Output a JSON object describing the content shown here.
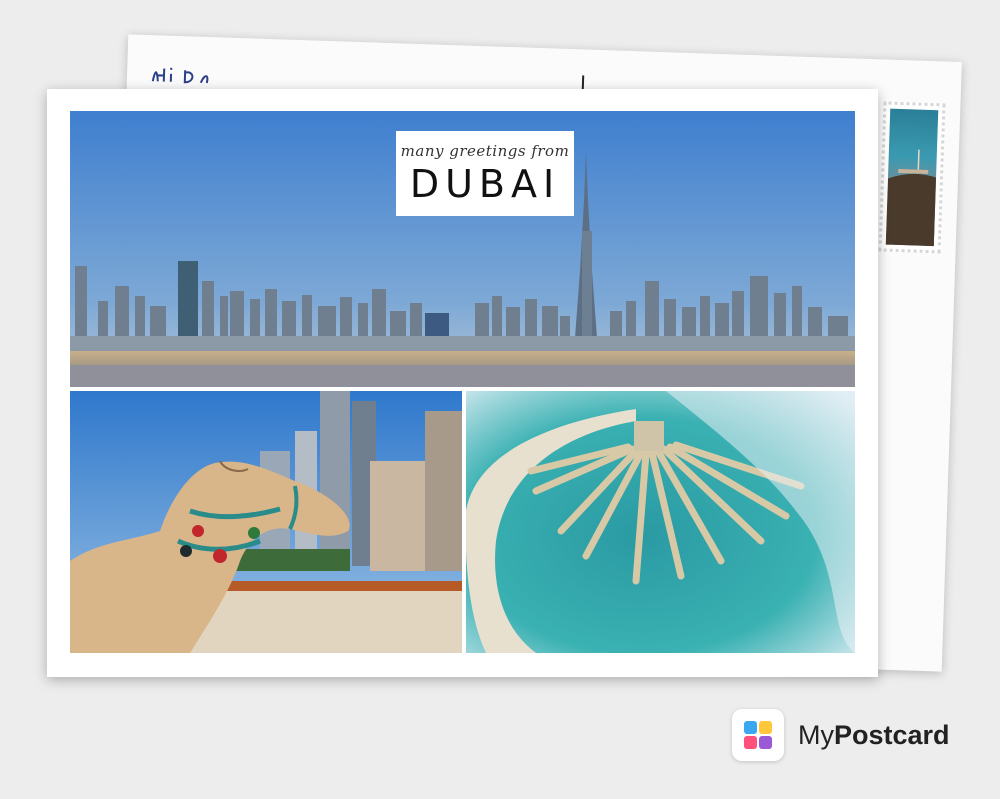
{
  "card_front": {
    "subtitle": "many greetings from",
    "title": "DUBAI"
  },
  "card_back": {
    "script_text": "Hi D..."
  },
  "brand": {
    "name_part1": "My",
    "name_part2": "Postcard",
    "logo_colors": [
      "#3aa8f0",
      "#ffc83a",
      "#ff4f7b",
      "#9b59d6"
    ]
  },
  "colors": {
    "sky": "#4a86cf",
    "sea": "#2a9aa3",
    "sand": "#e7d7bb",
    "background": "#ededed"
  },
  "photos": [
    {
      "name": "dubai-skyline",
      "icon": "skyline-photo"
    },
    {
      "name": "camel",
      "icon": "camel-photo"
    },
    {
      "name": "palm-island",
      "icon": "palm-island-photo"
    }
  ]
}
